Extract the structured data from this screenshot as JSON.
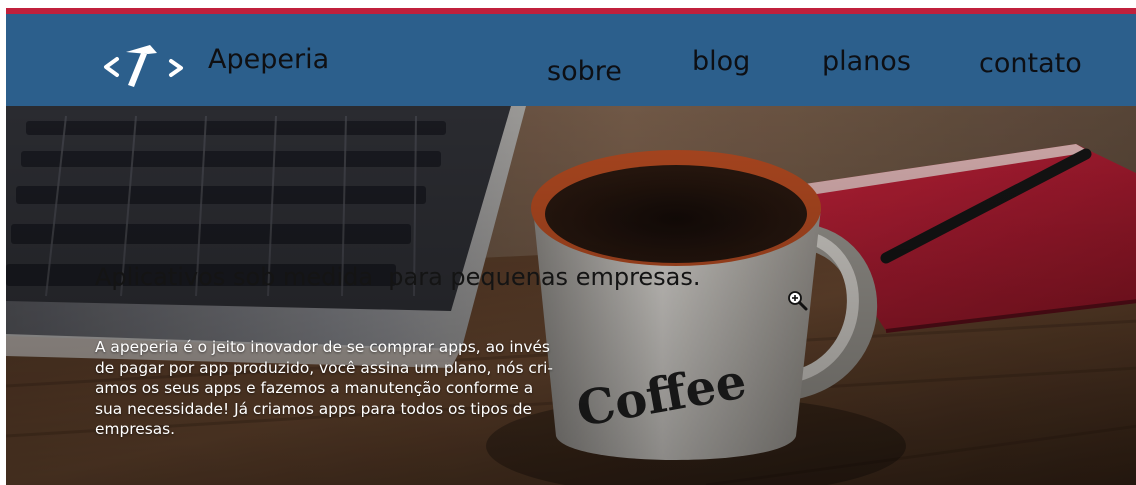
{
  "brand": {
    "name": "Apeperia",
    "logo": "code-hammer-icon"
  },
  "nav": {
    "items": [
      {
        "label": "sobre"
      },
      {
        "label": "blog"
      },
      {
        "label": "planos"
      },
      {
        "label": "contato"
      }
    ]
  },
  "hero": {
    "headline": "Aplicativos sob medida  para pequenas empresas.",
    "body_lines": [
      "A apeperia é o jeito inovador de se comprar apps, ao invés",
      "de pagar por app produzido, você assina um plano, nós cri-",
      "amos os seus apps e fazemos a manutenção conforme a",
      "sua necessidade! Já criamos apps para todos os tipos de",
      "empresas."
    ],
    "mug_text": "Coffee",
    "background": "laptop-coffee-notebook-photo"
  },
  "cursor": "zoom-in-cursor-icon",
  "colors": {
    "top_accent": "#c0203c",
    "navbar": "#2c5f8c",
    "nav_text": "#0d0f14"
  }
}
